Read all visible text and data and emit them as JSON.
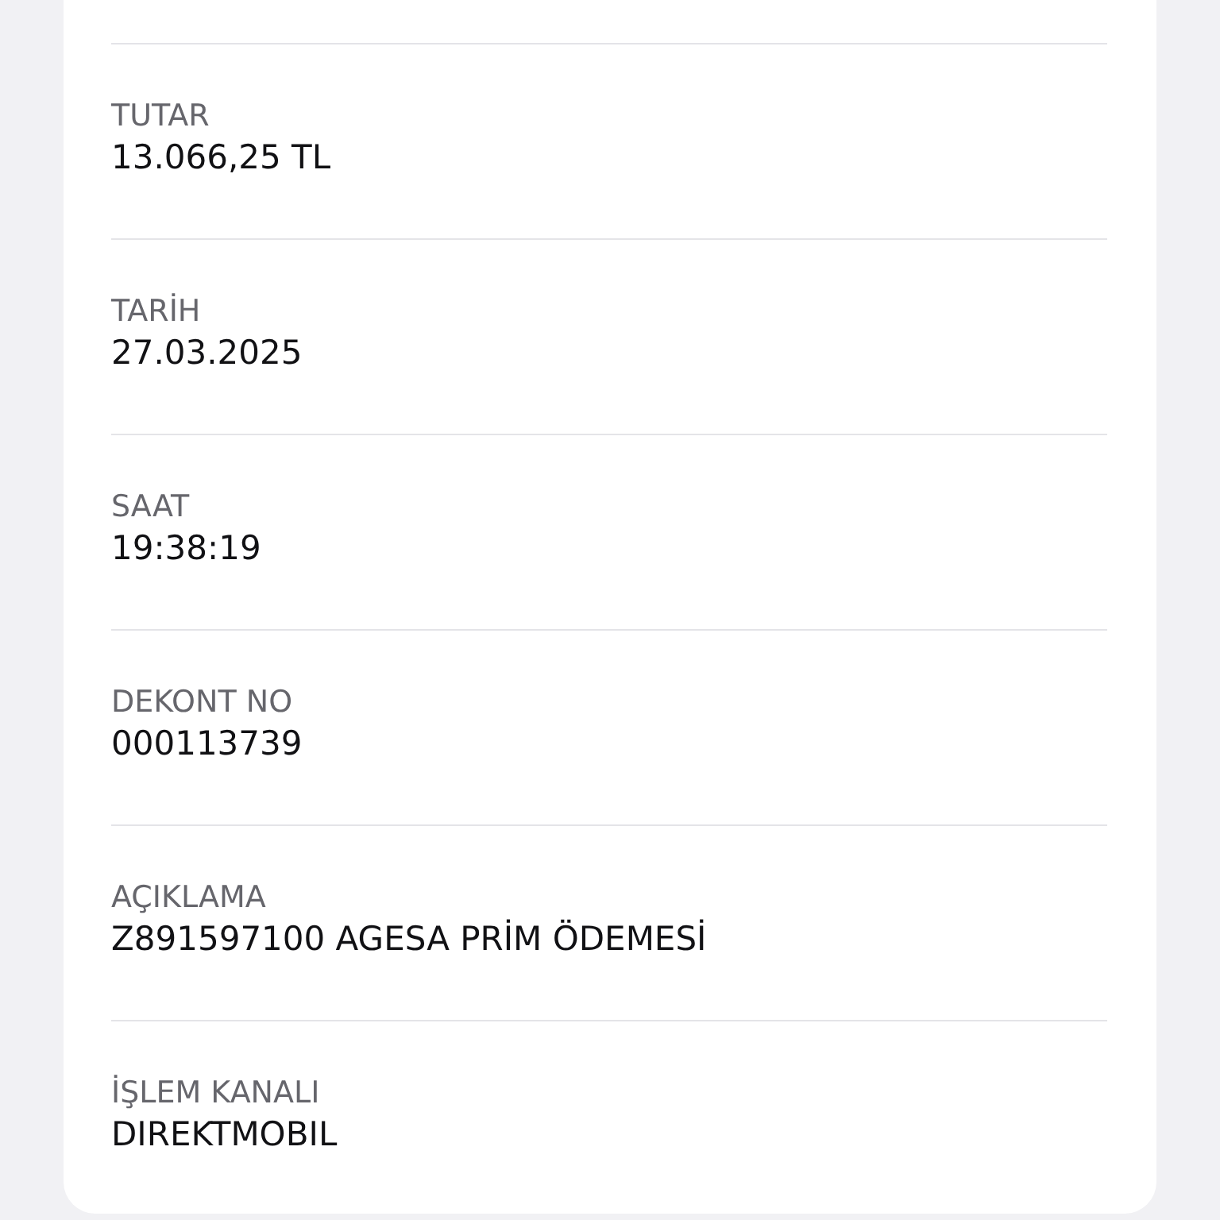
{
  "details": [
    {
      "label": "TUTAR",
      "value": "13.066,25 TL"
    },
    {
      "label": "TARİH",
      "value": "27.03.2025"
    },
    {
      "label": "SAAT",
      "value": "19:38:19"
    },
    {
      "label": "DEKONT NO",
      "value": "000113739"
    },
    {
      "label": "AÇIKLAMA",
      "value": "Z891597100 AGESA PRİM ÖDEMESİ"
    },
    {
      "label": "İŞLEM KANALI",
      "value": "DIREKTMOBIL"
    }
  ]
}
